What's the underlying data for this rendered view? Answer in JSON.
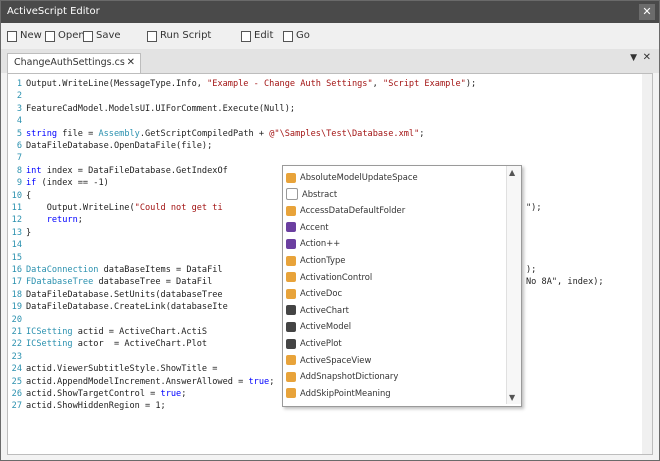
{
  "window": {
    "title": "ActiveScript Editor",
    "close_glyph": "✕"
  },
  "toolbar": [
    {
      "label": "New",
      "icon": "new-file-icon"
    },
    {
      "label": "Open",
      "icon": "open-folder-icon"
    },
    {
      "label": "Save",
      "icon": "save-icon"
    },
    {
      "label": "Run Script",
      "icon": "run-icon"
    },
    {
      "label": "Edit",
      "icon": "edit-icon"
    },
    {
      "label": "Go",
      "icon": "go-icon"
    }
  ],
  "tab": {
    "label": "ChangeAuthSettings.cs",
    "close": "✕"
  },
  "pane": {
    "pin": "▼",
    "close": "✕"
  },
  "code": [
    {
      "n": "1",
      "parts": [
        [
          "",
          "Output.WriteLine(MessageType.Info, "
        ],
        [
          "st",
          "\"Example - Change Auth Settings\""
        ],
        [
          "",
          ", "
        ],
        [
          "st",
          "\"Script Example\""
        ],
        [
          "",
          ");"
        ]
      ]
    },
    {
      "n": "2",
      "parts": [
        [
          "",
          ""
        ]
      ]
    },
    {
      "n": "3",
      "parts": [
        [
          "",
          "FeatureCadModel.ModelsUI.UIForComment.Execute(Null);"
        ]
      ]
    },
    {
      "n": "4",
      "parts": [
        [
          "",
          ""
        ]
      ]
    },
    {
      "n": "5",
      "parts": [
        [
          "kw",
          "string"
        ],
        [
          "",
          " file = "
        ],
        [
          "ty",
          "Assembly"
        ],
        [
          "",
          ".GetScriptCompiledPath + "
        ],
        [
          "st",
          "@\"\\Samples\\Test\\Database.xml\""
        ],
        [
          "",
          ";"
        ]
      ]
    },
    {
      "n": "6",
      "parts": [
        [
          "",
          "DataFileDatabase.OpenDataFile(file);"
        ]
      ]
    },
    {
      "n": "7",
      "parts": [
        [
          "",
          ""
        ]
      ]
    },
    {
      "n": "8",
      "parts": [
        [
          "kw",
          "int"
        ],
        [
          "",
          " index = DataFileDatabase.GetIndexOf"
        ]
      ]
    },
    {
      "n": "9",
      "parts": [
        [
          "kw",
          "if"
        ],
        [
          "",
          " (index == -1)"
        ]
      ]
    },
    {
      "n": "10",
      "parts": [
        [
          "",
          "{"
        ]
      ]
    },
    {
      "n": "11",
      "parts": [
        [
          "",
          "    Output.WriteLine("
        ],
        [
          "st",
          "\"Could not get ti"
        ]
      ]
    },
    {
      "n": "12",
      "parts": [
        [
          "",
          "    "
        ],
        [
          "kw",
          "return"
        ],
        [
          "",
          ";"
        ]
      ]
    },
    {
      "n": "13",
      "parts": [
        [
          "",
          "}"
        ]
      ]
    },
    {
      "n": "14",
      "parts": [
        [
          "",
          ""
        ]
      ]
    },
    {
      "n": "15",
      "parts": [
        [
          "",
          ""
        ]
      ]
    },
    {
      "n": "16",
      "parts": [
        [
          "ty",
          "DataConnection"
        ],
        [
          "",
          " dataBaseItems = DataFil"
        ]
      ]
    },
    {
      "n": "17",
      "parts": [
        [
          "ty",
          "FDatabaseTree"
        ],
        [
          "",
          " databaseTree = DataFil"
        ]
      ]
    },
    {
      "n": "18",
      "parts": [
        [
          "",
          "DataFileDatabase.SetUnits(databaseTree"
        ]
      ]
    },
    {
      "n": "19",
      "parts": [
        [
          "",
          "DataFileDatabase.CreateLink(databaseIte"
        ]
      ]
    },
    {
      "n": "20",
      "parts": [
        [
          "",
          ""
        ]
      ]
    },
    {
      "n": "21",
      "parts": [
        [
          "ty",
          "ICSetting"
        ],
        [
          "",
          " actid = ActiveChart.ActiS"
        ]
      ]
    },
    {
      "n": "22",
      "parts": [
        [
          "ty",
          "ICSetting"
        ],
        [
          "",
          " actor  = ActiveChart.Plot"
        ]
      ]
    },
    {
      "n": "23",
      "parts": [
        [
          "",
          ""
        ]
      ]
    },
    {
      "n": "24",
      "parts": [
        [
          "",
          "actid.ViewerSubtitleStyle.ShowTitle = "
        ]
      ]
    },
    {
      "n": "25",
      "parts": [
        [
          "",
          "actid.AppendModelIncrement.AnswerAllowed = "
        ],
        [
          "kw",
          "true"
        ],
        [
          "",
          ";"
        ]
      ]
    },
    {
      "n": "26",
      "parts": [
        [
          "",
          "actid.ShowTargetControl = "
        ],
        [
          "kw",
          "true"
        ],
        [
          "",
          ";"
        ]
      ]
    },
    {
      "n": "27",
      "parts": [
        [
          "",
          "actid.ShowHiddenRegion = 1;"
        ]
      ]
    }
  ],
  "code_right": [
    {
      "row": 11,
      "text": "\");"
    },
    {
      "row": 16,
      "text": ");"
    },
    {
      "row": 17,
      "text": "No 8A\", index);"
    }
  ],
  "autocomplete": {
    "items": [
      {
        "label": "AbsoluteModelUpdateSpace",
        "kind": "property",
        "color": "#e8a33a"
      },
      {
        "label": "Abstract",
        "kind": "method",
        "color": "#ffffff"
      },
      {
        "label": "AccessDataDefaultFolder",
        "kind": "property",
        "color": "#e8a33a"
      },
      {
        "label": "Accent",
        "kind": "class",
        "color": "#6b3fa0"
      },
      {
        "label": "Action++",
        "kind": "class",
        "color": "#6b3fa0"
      },
      {
        "label": "ActionType",
        "kind": "event",
        "color": "#e8a33a"
      },
      {
        "label": "ActivationControl",
        "kind": "property",
        "color": "#e8a33a"
      },
      {
        "label": "ActiveDoc",
        "kind": "property",
        "color": "#e8a33a"
      },
      {
        "label": "ActiveChart",
        "kind": "field",
        "color": "#444444"
      },
      {
        "label": "ActiveModel",
        "kind": "field",
        "color": "#444444"
      },
      {
        "label": "ActivePlot",
        "kind": "field",
        "color": "#444444"
      },
      {
        "label": "ActiveSpaceView",
        "kind": "property",
        "color": "#e8a33a"
      },
      {
        "label": "AddSnapshotDictionary",
        "kind": "property",
        "color": "#e8a33a"
      },
      {
        "label": "AddSkipPointMeaning",
        "kind": "property",
        "color": "#e8a33a"
      }
    ]
  }
}
